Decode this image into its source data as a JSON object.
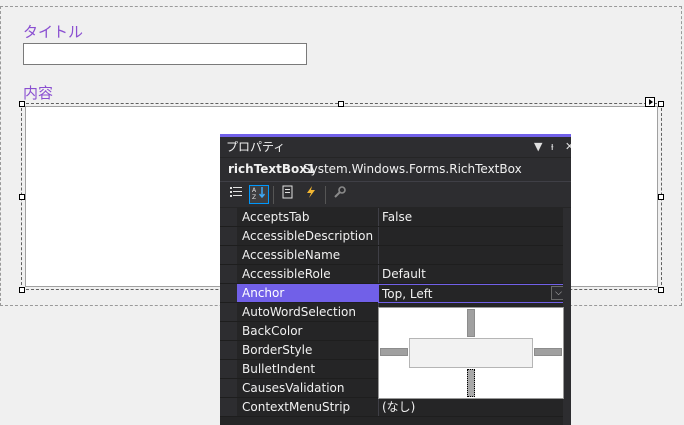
{
  "form": {
    "title_label": "タイトル",
    "title_value": "",
    "content_label": "内容"
  },
  "properties": {
    "window_title": "プロパティ",
    "titlebar_buttons": {
      "dropdown": "▼",
      "pin": "ᵼ",
      "close": "✕"
    },
    "object_name": "richTextBox1",
    "object_type": "System.Windows.Forms.RichTextBox",
    "toolbar": {
      "categorized_icon": "categorized-icon",
      "alphabetical_icon": "alphabetical-icon",
      "properties_icon": "properties-icon",
      "events_icon": "events-icon",
      "property_pages_icon": "wrench-icon"
    },
    "rows": [
      {
        "name": "AcceptsTab",
        "value": "False"
      },
      {
        "name": "AccessibleDescription",
        "value": ""
      },
      {
        "name": "AccessibleName",
        "value": ""
      },
      {
        "name": "AccessibleRole",
        "value": "Default"
      },
      {
        "name": "Anchor",
        "value": "Top, Left",
        "selected": true
      },
      {
        "name": "AutoWordSelection",
        "value": ""
      },
      {
        "name": "BackColor",
        "value": ""
      },
      {
        "name": "BorderStyle",
        "value": ""
      },
      {
        "name": "BulletIndent",
        "value": ""
      },
      {
        "name": "CausesValidation",
        "value": ""
      },
      {
        "name": "ContextMenuStrip",
        "value": "(なし)"
      }
    ],
    "anchor_editor": {
      "top": true,
      "left": true,
      "right": false,
      "bottom": false,
      "focused": "bottom"
    }
  },
  "colors": {
    "accent": "#7160e8",
    "label": "#8a4fd1",
    "panel_bg": "#252526"
  }
}
